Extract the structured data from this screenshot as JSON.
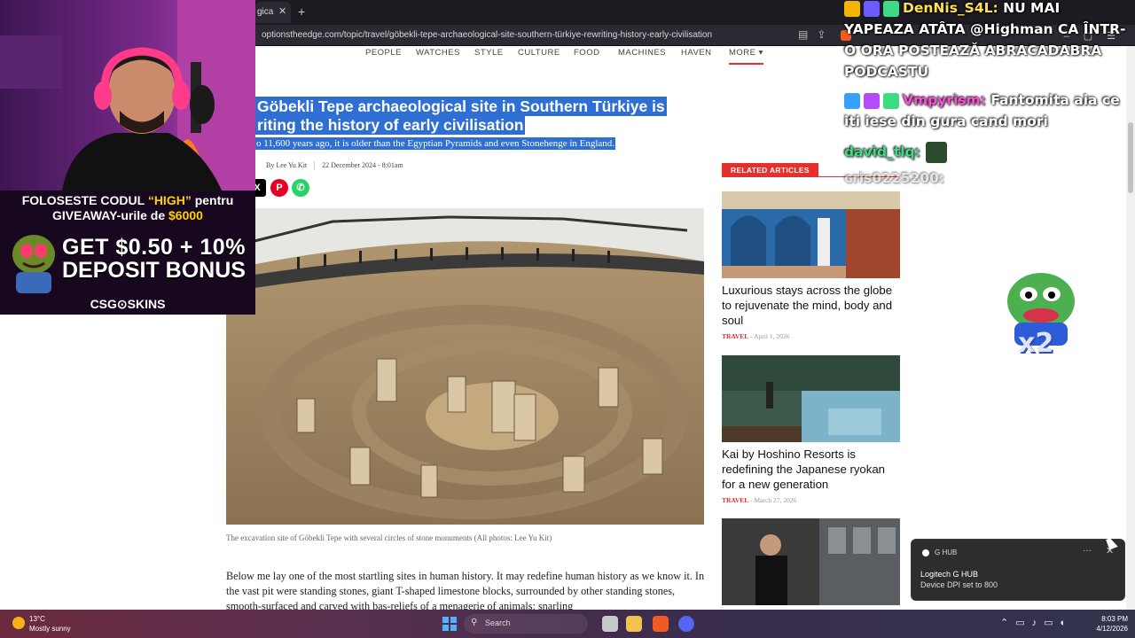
{
  "browser": {
    "tab_title": "gica",
    "url": "optionstheedge.com/topic/travel/göbekli-tepe-archaeological-site-southern-türkiye-rewriting-history-early-civilisation"
  },
  "nav": {
    "items": [
      "PEOPLE",
      "WATCHES",
      "STYLE",
      "CULTURE",
      "FOOD",
      "MACHINES",
      "HAVEN"
    ],
    "more": "MORE ▾"
  },
  "article": {
    "headline_line1": "Göbekli Tepe archaeological site in Southern Türkiye is",
    "headline_line2": "riting the history of early civilisation",
    "standfirst": "o 11,600 years ago, it is older than the Egyptian Pyramids and even Stonehenge in England.",
    "author": "By Lee Yu Kit",
    "date": "22 December 2024 - 8:01am",
    "caption": "The excavation site of Göbekli Tepe with several circles of stone monuments (All photos: Lee Yu Kit)",
    "body": "Below me lay one of the most startling sites in human history. It may redefine human history as we know it. In the vast pit were standing stones, giant T-shaped limestone blocks, surrounded by other standing stones, smooth-surfaced and carved with bas-reliefs of a menagerie of animals: snarling"
  },
  "share": {
    "x": "X",
    "pinterest": "P",
    "whatsapp": "✆"
  },
  "related": {
    "heading": "RELATED ARTICLES",
    "items": [
      {
        "title": "Luxurious stays across the globe to rejuvenate the mind, body and soul",
        "category": "TRAVEL",
        "date": "April 1, 2026"
      },
      {
        "title": "Kai by Hoshino Resorts is redefining the Japanese ryokan for a new generation",
        "category": "TRAVEL",
        "date": "March 27, 2026"
      }
    ]
  },
  "promo": {
    "line1_a": "FOLOSESTE CODUL ",
    "line1_code": "“HIGH”",
    "line1_b": " pentru",
    "line2_a": "GIVEAWAY-urile de ",
    "line2_amount": "$6000",
    "bonus1": "GET $0.50 + 10%",
    "bonus2": "DEPOSIT BONUS",
    "brand": "CSG⊙SKINS"
  },
  "chat": {
    "msg1_user": "DenNis_S4L:",
    "msg1_text": " NU MAI",
    "msg1_cont1": "YAPEAZA ATÂTA @Highman CA ÎNTR-",
    "msg1_cont2": "O ORA POSTEAZĂ ABRACADABRA",
    "msg1_cont3": "PODCASTU",
    "msg2_user": "Vmpyrism:",
    "msg2_text": " Fantomita aia ce",
    "msg2_cont": "iti iese din gura cand mori",
    "msg3_user": "david_tlq:",
    "msg4_user": "cris0225200:",
    "emote_multiplier": "x2"
  },
  "toast": {
    "app": "G HUB",
    "title": "Logitech G HUB",
    "message": "Device DPI set to 800"
  },
  "taskbar": {
    "temp": "13°C",
    "condition": "Mostly sunny",
    "search": "Search",
    "time": "8:03 PM",
    "date": "4/12/2026"
  },
  "colors": {
    "accent": "#e62e2d",
    "selection": "#2f6fd4",
    "chat_user1": "#ffe14d",
    "chat_user2": "#ff4fd8",
    "chat_user3": "#3ddc84"
  }
}
